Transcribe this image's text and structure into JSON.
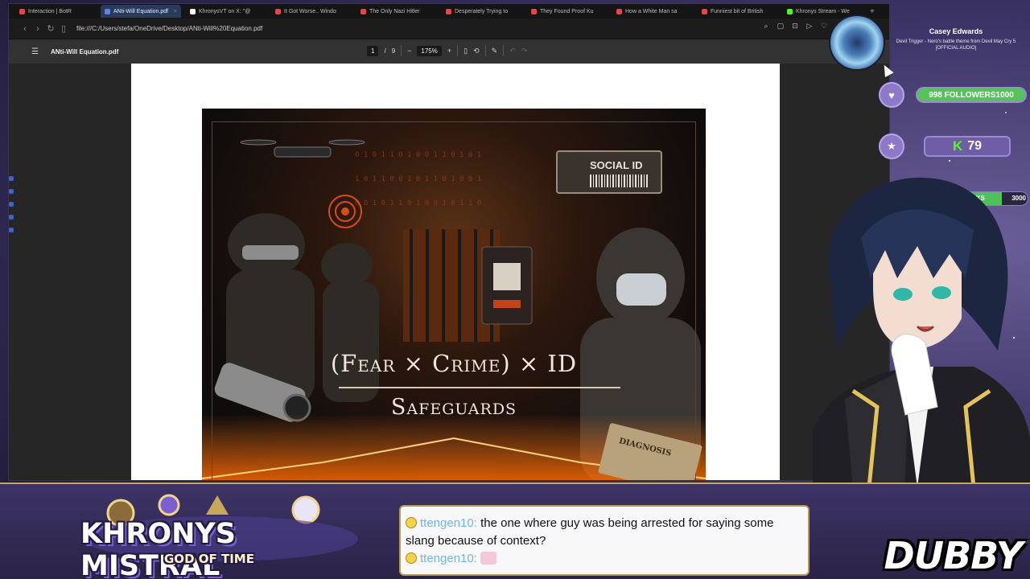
{
  "browser": {
    "tabs": [
      {
        "label": "Interaction | BotR",
        "color": "#e54646",
        "active": false
      },
      {
        "label": "ANti-Will Equation.pdf",
        "color": "#5a86e0",
        "active": true
      },
      {
        "label": "KhronysVT on X: \"@",
        "color": "#ffffff",
        "active": false
      },
      {
        "label": "It Got Worse.. Windo",
        "color": "#e54646",
        "active": false
      },
      {
        "label": "The Only Nazi Hitler",
        "color": "#e54646",
        "active": false
      },
      {
        "label": "Desperately Trying to",
        "color": "#e54646",
        "active": false
      },
      {
        "label": "They Found Proof Ku",
        "color": "#e54646",
        "active": false
      },
      {
        "label": "How a White Man sa",
        "color": "#e54646",
        "active": false
      },
      {
        "label": "Funniest bit of British",
        "color": "#e54646",
        "active": false
      },
      {
        "label": "Khronys Stream - We",
        "color": "#53fc18",
        "active": false
      }
    ],
    "url": "file:///C:/Users/stefa/OneDrive/Desktop/ANti-Will%20Equation.pdf"
  },
  "pdf": {
    "title": "ANti-Will Equation.pdf",
    "page_current": "1",
    "page_total": "9",
    "zoom": "175%"
  },
  "poster": {
    "badge": "SOCIAL ID",
    "title": "(Fear × Crime) × ID",
    "subtitle": "Safeguards",
    "clipboard": "DIAGNOSIS"
  },
  "overlay": {
    "now_playing_name": "Casey Edwards",
    "now_playing_track": "Devil Trigger - Nero's battle theme from Devil May Cry 5 [OFFICIAL AUDIO]",
    "followers_current": "998",
    "followers_label": "FOLLOWERS",
    "followers_goal": "1000",
    "followers_progress": 0.998,
    "kick_count": "79",
    "kicks_label": "CKS",
    "kicks_goal": "3000",
    "kicks_progress": 0.6,
    "logo_title": "KHRONYS MISTRAL",
    "logo_subtitle": "GOD OF TIME",
    "brand": "DUBBY",
    "accent_color": "#c7a85a"
  },
  "chat": [
    {
      "user": "ttengen10:",
      "message": "the one where guy was being arrested for saying some slang because of context?"
    },
    {
      "user": "ttengen10:",
      "message": ""
    }
  ]
}
